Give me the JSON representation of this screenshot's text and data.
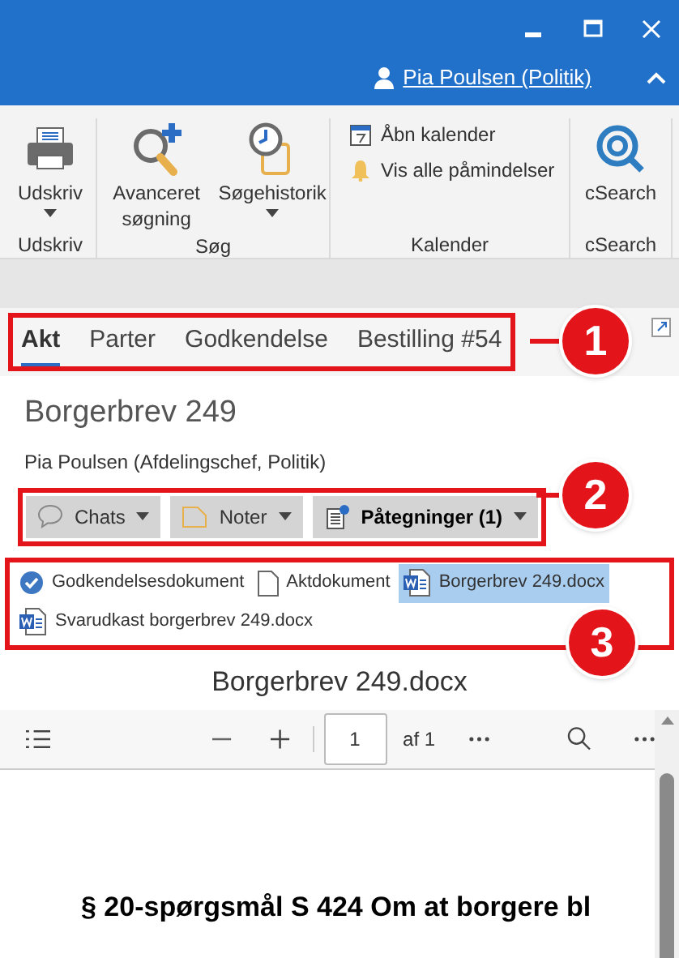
{
  "user": {
    "name": "Pia Poulsen (Politik)"
  },
  "ribbon": {
    "groups": [
      {
        "label": "Udskriv",
        "items": [
          {
            "kind": "large",
            "label": "Udskriv",
            "dropdown": true
          }
        ]
      },
      {
        "label": "Søg",
        "items": [
          {
            "kind": "large",
            "label": "Avanceret søgning",
            "dropdown": false
          },
          {
            "kind": "large",
            "label": "Søgehistorik",
            "dropdown": true
          }
        ]
      },
      {
        "label": "Kalender",
        "items": [
          {
            "kind": "small",
            "label": "Åbn kalender"
          },
          {
            "kind": "small",
            "label": "Vis alle påmindelser"
          }
        ]
      },
      {
        "label": "cSearch",
        "items": [
          {
            "kind": "large",
            "label": "cSearch",
            "dropdown": false
          }
        ]
      }
    ]
  },
  "tabs": [
    {
      "label": "Akt",
      "selected": true
    },
    {
      "label": "Parter",
      "selected": false
    },
    {
      "label": "Godkendelse",
      "selected": false
    },
    {
      "label": "Bestilling #54",
      "selected": false
    }
  ],
  "case": {
    "title": "Borgerbrev 249",
    "subtitle": "Pia Poulsen (Afdelingschef, Politik)"
  },
  "actions": [
    {
      "label": "Chats",
      "emphasized": false
    },
    {
      "label": "Noter",
      "emphasized": false
    },
    {
      "label": "Påtegninger (1)",
      "emphasized": true
    }
  ],
  "documents": [
    {
      "kind": "approval",
      "label": "Godkendelsesdokument",
      "selected": false
    },
    {
      "kind": "blank",
      "label": "Aktdokument",
      "selected": false
    },
    {
      "kind": "word",
      "label": "Borgerbrev 249.docx",
      "selected": true
    },
    {
      "kind": "word",
      "label": "Svarudkast borgerbrev 249.docx",
      "selected": false
    }
  ],
  "viewer": {
    "title": "Borgerbrev 249.docx",
    "page": "1",
    "page_count": "af 1",
    "content": "§ 20-spørgsmål S 424 Om at borgere bl"
  },
  "callouts": [
    "1",
    "2",
    "3"
  ]
}
